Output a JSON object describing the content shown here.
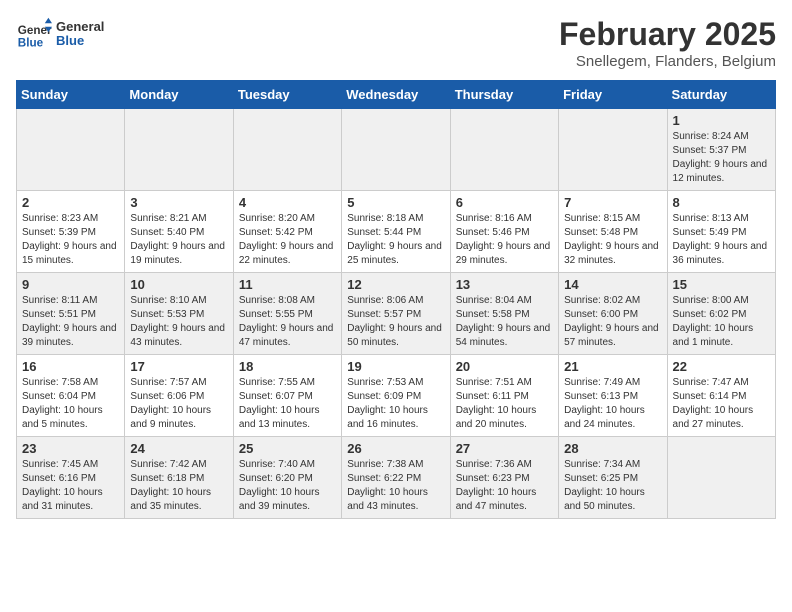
{
  "header": {
    "logo_text_general": "General",
    "logo_text_blue": "Blue",
    "month_title": "February 2025",
    "location": "Snellegem, Flanders, Belgium"
  },
  "days_of_week": [
    "Sunday",
    "Monday",
    "Tuesday",
    "Wednesday",
    "Thursday",
    "Friday",
    "Saturday"
  ],
  "weeks": [
    {
      "shaded": true,
      "days": [
        {
          "num": "",
          "info": ""
        },
        {
          "num": "",
          "info": ""
        },
        {
          "num": "",
          "info": ""
        },
        {
          "num": "",
          "info": ""
        },
        {
          "num": "",
          "info": ""
        },
        {
          "num": "",
          "info": ""
        },
        {
          "num": "1",
          "info": "Sunrise: 8:24 AM\nSunset: 5:37 PM\nDaylight: 9 hours and 12 minutes."
        }
      ]
    },
    {
      "shaded": false,
      "days": [
        {
          "num": "2",
          "info": "Sunrise: 8:23 AM\nSunset: 5:39 PM\nDaylight: 9 hours and 15 minutes."
        },
        {
          "num": "3",
          "info": "Sunrise: 8:21 AM\nSunset: 5:40 PM\nDaylight: 9 hours and 19 minutes."
        },
        {
          "num": "4",
          "info": "Sunrise: 8:20 AM\nSunset: 5:42 PM\nDaylight: 9 hours and 22 minutes."
        },
        {
          "num": "5",
          "info": "Sunrise: 8:18 AM\nSunset: 5:44 PM\nDaylight: 9 hours and 25 minutes."
        },
        {
          "num": "6",
          "info": "Sunrise: 8:16 AM\nSunset: 5:46 PM\nDaylight: 9 hours and 29 minutes."
        },
        {
          "num": "7",
          "info": "Sunrise: 8:15 AM\nSunset: 5:48 PM\nDaylight: 9 hours and 32 minutes."
        },
        {
          "num": "8",
          "info": "Sunrise: 8:13 AM\nSunset: 5:49 PM\nDaylight: 9 hours and 36 minutes."
        }
      ]
    },
    {
      "shaded": true,
      "days": [
        {
          "num": "9",
          "info": "Sunrise: 8:11 AM\nSunset: 5:51 PM\nDaylight: 9 hours and 39 minutes."
        },
        {
          "num": "10",
          "info": "Sunrise: 8:10 AM\nSunset: 5:53 PM\nDaylight: 9 hours and 43 minutes."
        },
        {
          "num": "11",
          "info": "Sunrise: 8:08 AM\nSunset: 5:55 PM\nDaylight: 9 hours and 47 minutes."
        },
        {
          "num": "12",
          "info": "Sunrise: 8:06 AM\nSunset: 5:57 PM\nDaylight: 9 hours and 50 minutes."
        },
        {
          "num": "13",
          "info": "Sunrise: 8:04 AM\nSunset: 5:58 PM\nDaylight: 9 hours and 54 minutes."
        },
        {
          "num": "14",
          "info": "Sunrise: 8:02 AM\nSunset: 6:00 PM\nDaylight: 9 hours and 57 minutes."
        },
        {
          "num": "15",
          "info": "Sunrise: 8:00 AM\nSunset: 6:02 PM\nDaylight: 10 hours and 1 minute."
        }
      ]
    },
    {
      "shaded": false,
      "days": [
        {
          "num": "16",
          "info": "Sunrise: 7:58 AM\nSunset: 6:04 PM\nDaylight: 10 hours and 5 minutes."
        },
        {
          "num": "17",
          "info": "Sunrise: 7:57 AM\nSunset: 6:06 PM\nDaylight: 10 hours and 9 minutes."
        },
        {
          "num": "18",
          "info": "Sunrise: 7:55 AM\nSunset: 6:07 PM\nDaylight: 10 hours and 13 minutes."
        },
        {
          "num": "19",
          "info": "Sunrise: 7:53 AM\nSunset: 6:09 PM\nDaylight: 10 hours and 16 minutes."
        },
        {
          "num": "20",
          "info": "Sunrise: 7:51 AM\nSunset: 6:11 PM\nDaylight: 10 hours and 20 minutes."
        },
        {
          "num": "21",
          "info": "Sunrise: 7:49 AM\nSunset: 6:13 PM\nDaylight: 10 hours and 24 minutes."
        },
        {
          "num": "22",
          "info": "Sunrise: 7:47 AM\nSunset: 6:14 PM\nDaylight: 10 hours and 27 minutes."
        }
      ]
    },
    {
      "shaded": true,
      "days": [
        {
          "num": "23",
          "info": "Sunrise: 7:45 AM\nSunset: 6:16 PM\nDaylight: 10 hours and 31 minutes."
        },
        {
          "num": "24",
          "info": "Sunrise: 7:42 AM\nSunset: 6:18 PM\nDaylight: 10 hours and 35 minutes."
        },
        {
          "num": "25",
          "info": "Sunrise: 7:40 AM\nSunset: 6:20 PM\nDaylight: 10 hours and 39 minutes."
        },
        {
          "num": "26",
          "info": "Sunrise: 7:38 AM\nSunset: 6:22 PM\nDaylight: 10 hours and 43 minutes."
        },
        {
          "num": "27",
          "info": "Sunrise: 7:36 AM\nSunset: 6:23 PM\nDaylight: 10 hours and 47 minutes."
        },
        {
          "num": "28",
          "info": "Sunrise: 7:34 AM\nSunset: 6:25 PM\nDaylight: 10 hours and 50 minutes."
        },
        {
          "num": "",
          "info": ""
        }
      ]
    }
  ]
}
